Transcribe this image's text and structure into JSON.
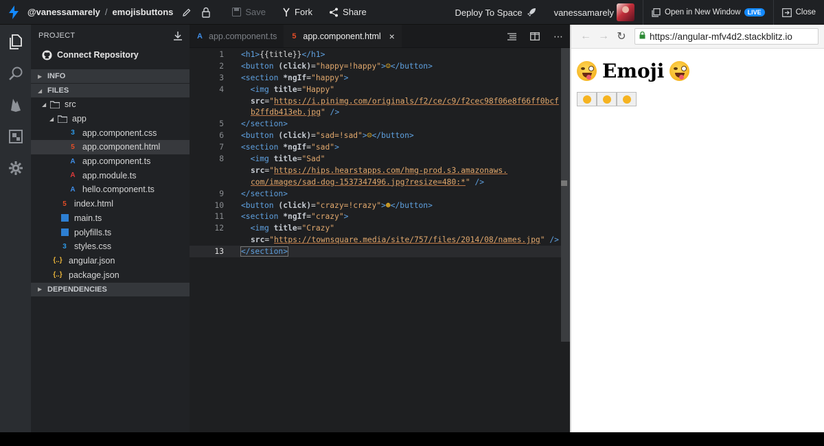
{
  "topbar": {
    "owner": "@vanessamarely",
    "separator": "/",
    "project": "emojisbuttons",
    "save": "Save",
    "fork": "Fork",
    "share": "Share",
    "deploy": "Deploy To Space",
    "username": "vanessamarely",
    "open_new_window": "Open in New Window",
    "live": "LIVE",
    "close": "Close"
  },
  "sidebar": {
    "title": "PROJECT",
    "connect": "Connect Repository",
    "sections": {
      "info": "INFO",
      "files": "FILES",
      "dependencies": "DEPENDENCIES"
    },
    "tree": [
      {
        "label": "src",
        "type": "folder"
      },
      {
        "label": "app",
        "type": "folder"
      },
      {
        "label": "app.component.css",
        "type": "css"
      },
      {
        "label": "app.component.html",
        "type": "html"
      },
      {
        "label": "app.component.ts",
        "type": "angular"
      },
      {
        "label": "app.module.ts",
        "type": "angular-red"
      },
      {
        "label": "hello.component.ts",
        "type": "angular"
      },
      {
        "label": "index.html",
        "type": "html"
      },
      {
        "label": "main.ts",
        "type": "ts"
      },
      {
        "label": "polyfills.ts",
        "type": "ts"
      },
      {
        "label": "styles.css",
        "type": "css"
      },
      {
        "label": "angular.json",
        "type": "json"
      },
      {
        "label": "package.json",
        "type": "json"
      }
    ]
  },
  "editor": {
    "tabs": [
      {
        "label": "app.component.ts"
      },
      {
        "label": "app.component.html",
        "close": "×"
      }
    ],
    "current_line": 13
  },
  "code": [
    {
      "n": "1"
    },
    {
      "n": "2"
    },
    {
      "n": "3"
    },
    {
      "n": "4"
    },
    {
      "n": ""
    },
    {
      "n": "5"
    },
    {
      "n": "6"
    },
    {
      "n": "7"
    },
    {
      "n": "8"
    },
    {
      "n": ""
    },
    {
      "n": "9"
    },
    {
      "n": "10"
    },
    {
      "n": "11"
    },
    {
      "n": "12"
    },
    {
      "n": ""
    },
    {
      "n": "13"
    }
  ],
  "code_text": {
    "l1": {
      "a": "<h1>",
      "b": "{{title}}",
      "c": "</h1>"
    },
    "l2": {
      "a": "<button",
      "b": " (click)",
      "c": "=",
      "d": "\"happy=!happy\"",
      "e": ">",
      "f": "☺",
      "g": "</button>"
    },
    "l3": {
      "a": "<section",
      "b": " *ngIf",
      "c": "=",
      "d": "\"happy\"",
      "e": ">"
    },
    "l4": {
      "a": "  <img",
      "b": " title",
      "c": "=",
      "d": "\"Happy\""
    },
    "l4b": {
      "a": "src",
      "b": "=",
      "c": "\"",
      "d": "https://i.pinimg.com/originals/f2/ce/c9/f2cec98f06e8f66ff0bcf"
    },
    "l4c": {
      "a": "b2ffdb413eb.jpg",
      "b": "\"",
      "c": " />"
    },
    "l5": {
      "a": "</section>"
    },
    "l6": {
      "a": "<button",
      "b": " (click)",
      "c": "=",
      "d": "\"sad=!sad\"",
      "e": ">",
      "f": "☹",
      "g": "</button>"
    },
    "l7": {
      "a": "<section",
      "b": " *ngIf",
      "c": "=",
      "d": "\"sad\"",
      "e": ">"
    },
    "l8": {
      "a": "  <img",
      "b": " title",
      "c": "=",
      "d": "\"Sad\""
    },
    "l8b": {
      "a": "src",
      "b": "=",
      "c": "\"",
      "d": "https://hips.hearstapps.com/hmg-prod.s3.amazonaws."
    },
    "l8c": {
      "a": "com/images/sad-dog-1537347496.jpg?resize=480:*",
      "b": "\"",
      "c": " />"
    },
    "l9": {
      "a": "</section>"
    },
    "l10": {
      "a": "<button",
      "b": " (click)",
      "c": "=",
      "d": "\"crazy=!crazy\"",
      "e": ">",
      "f": "☻",
      "g": "</button>"
    },
    "l11": {
      "a": "<section",
      "b": " *ngIf",
      "c": "=",
      "d": "\"crazy\"",
      "e": ">"
    },
    "l12": {
      "a": "  <img",
      "b": " title",
      "c": "=",
      "d": "\"Crazy\""
    },
    "l12b": {
      "a": "src",
      "b": "=",
      "c": "\"",
      "d": "https://townsquare.media/site/757/files/2014/08/names.jpg",
      "e": "\"",
      "f": " />"
    },
    "l13": {
      "a": "</section>"
    }
  },
  "preview": {
    "url": "https://angular-mfv4d2.stackblitz.io",
    "title": "Emoji",
    "colors": {
      "accent": "#1389fd",
      "url_lock": "#2d8a35"
    }
  }
}
